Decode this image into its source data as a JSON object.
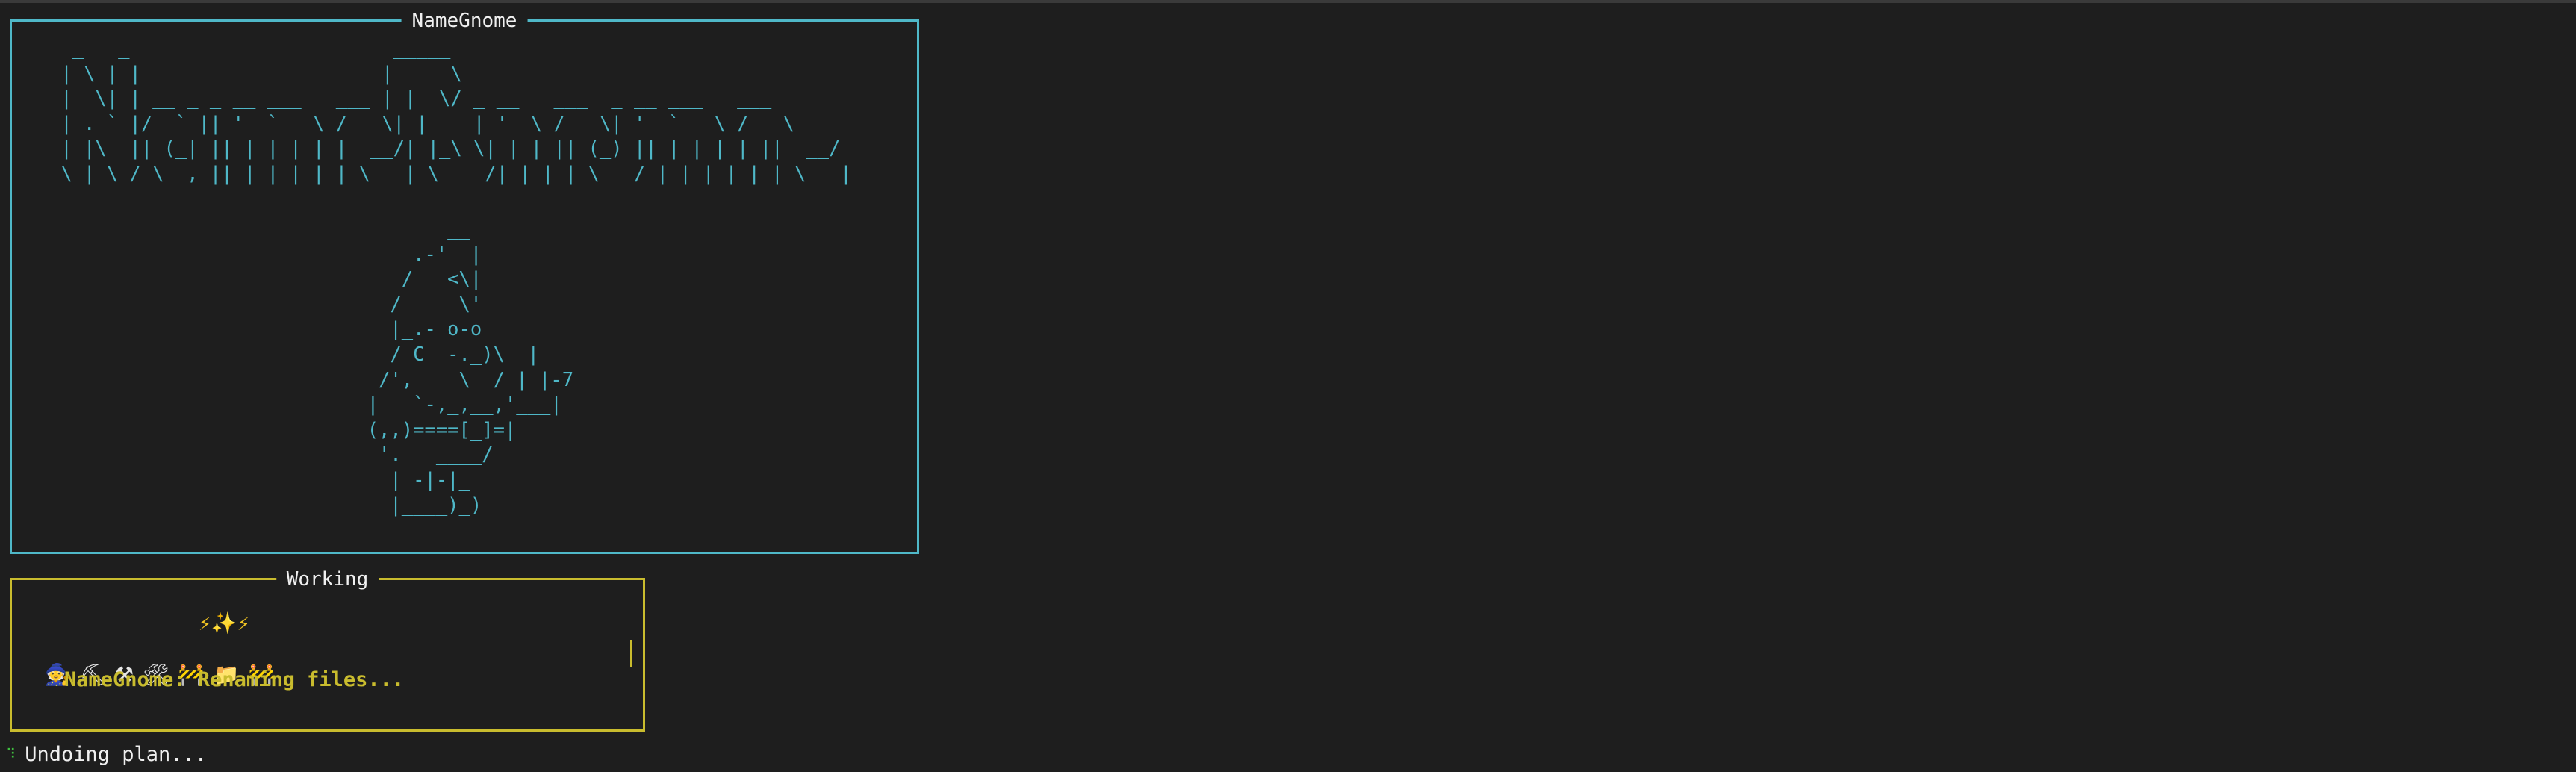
{
  "banner": {
    "title": "NameGnome",
    "logo_ascii": "  _   _                       _____\n | \\ | |                     |  __ \\\n |  \\| | __ _ _ __ ___   ___ | |  \\/ _ __   ___  _ __ ___   ___\n | . ` |/ _` || '_ ` _ \\ / _ \\| | __ | '_ \\ / _ \\| '_ ` _ \\ / _ \\\n | |\\  || (_| || | | | | |  __/| |_\\ \\| | | || (_) || | | | | ||  __/\n \\_| \\_/ \\__,_||_| |_| |_| \\___| \\____/|_| |_| \\___/ |_| |_| |_| \\___|",
    "gnome_ascii": "         __\n      .-'  |\n     /   <\\|\n    /     \\'\n    |_.- o-o\n    / C  -._)\\  |\n   /',    \\__/ |_|-7\n  |   `-,_,__,'___|\n  (,,)====[_]=|\n   '.   ____/\n    | -|-|_\n    |____)_)"
  },
  "working": {
    "title": "Working",
    "sparkles": "⚡✨⚡",
    "emoji_row": [
      "🧙",
      "⛏",
      "⚒",
      "🛠",
      "🚧",
      "📁",
      "🚧"
    ],
    "message": "NameGnome: Renaming files..."
  },
  "status": {
    "spinner": "⠹",
    "text": "Undoing plan..."
  }
}
